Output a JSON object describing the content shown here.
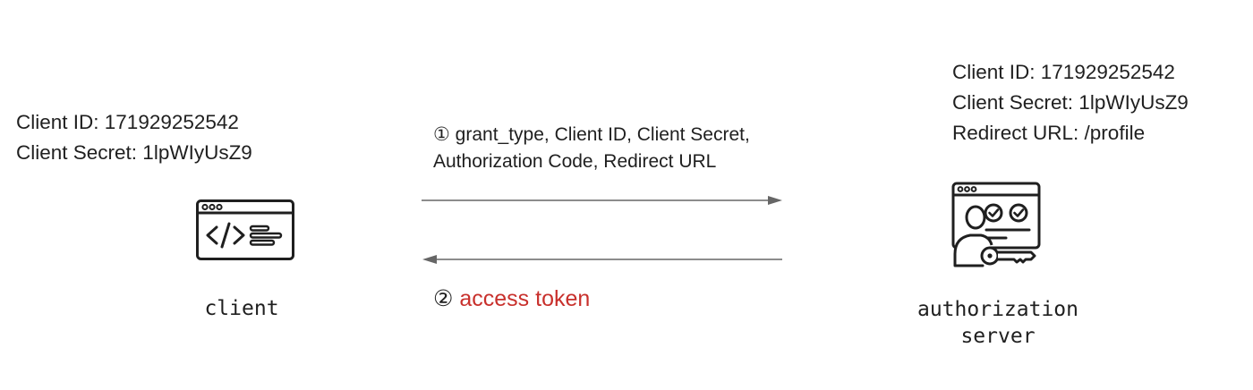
{
  "client": {
    "label": "client",
    "info": {
      "client_id": "Client ID: 171929252542",
      "client_secret": "Client Secret: 1lpWIyUsZ9"
    },
    "icon": "code-window-icon"
  },
  "server": {
    "label_line1": "authorization",
    "label_line2": "server",
    "info": {
      "client_id": "Client ID: 171929252542",
      "client_secret": "Client Secret: 1lpWIyUsZ9",
      "redirect_url": "Redirect URL: /profile"
    },
    "icon": "authorization-server-icon"
  },
  "messages": {
    "request": {
      "number": "①",
      "line1": "grant_type, Client ID, Client Secret,",
      "line2": "Authorization Code, Redirect URL"
    },
    "response": {
      "number": "②",
      "text": "access token",
      "color": "#c8302c"
    }
  },
  "colors": {
    "arrow": "#666666",
    "text": "#1f1f1f",
    "accent": "#c8302c"
  }
}
